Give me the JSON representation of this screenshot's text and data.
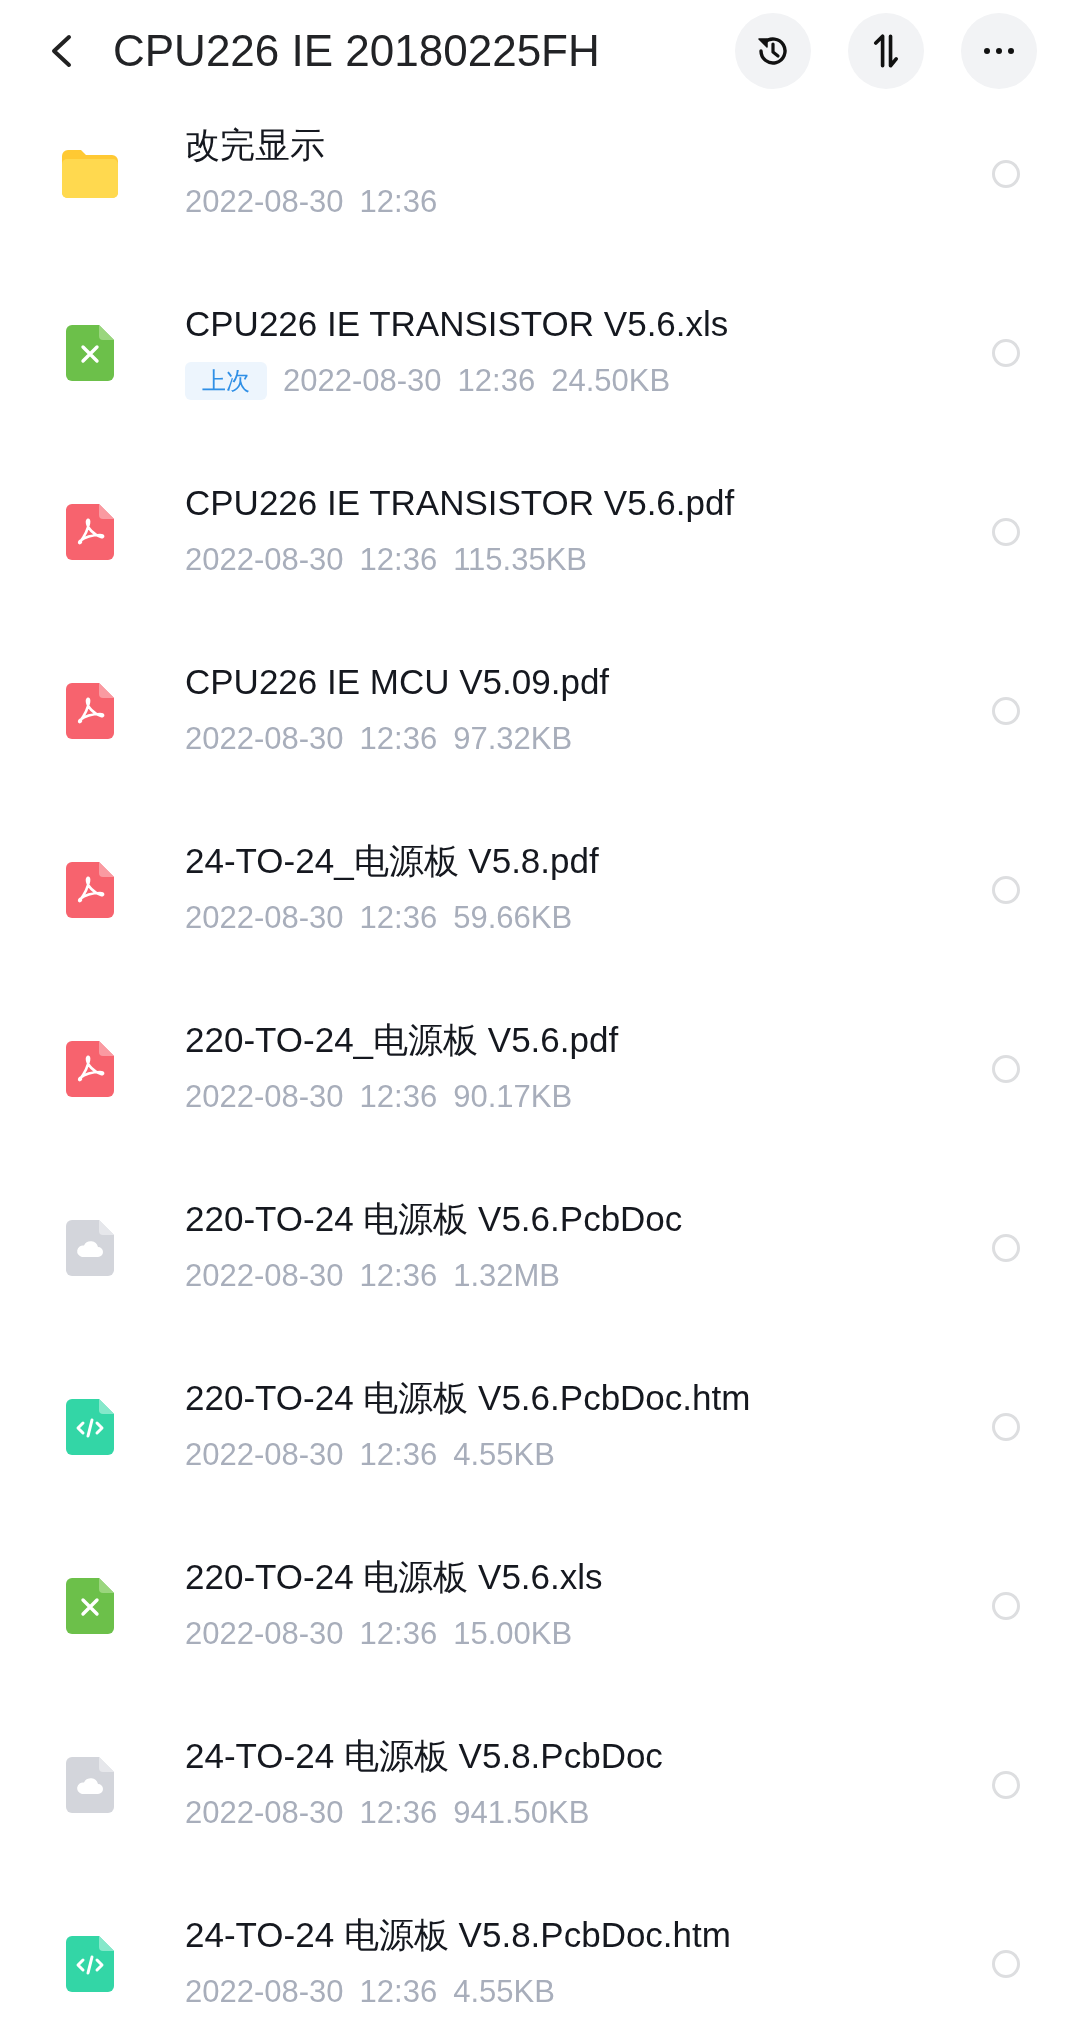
{
  "header": {
    "title": "CPU226 IE 20180225FH"
  },
  "files": [
    {
      "kind": "folder",
      "name": "改完显示",
      "date": "2022-08-30",
      "time": "12:36",
      "selected": false
    },
    {
      "kind": "sheet",
      "name": "CPU226 IE TRANSISTOR V5.6.xls",
      "badge": "上次",
      "date": "2022-08-30",
      "time": "12:36",
      "size": "24.50KB",
      "selected": false
    },
    {
      "kind": "pdf",
      "name": "CPU226 IE TRANSISTOR V5.6.pdf",
      "date": "2022-08-30",
      "time": "12:36",
      "size": "115.35KB",
      "selected": false
    },
    {
      "kind": "pdf",
      "name": "CPU226 IE MCU V5.09.pdf",
      "date": "2022-08-30",
      "time": "12:36",
      "size": "97.32KB",
      "selected": false
    },
    {
      "kind": "pdf",
      "name": "24-TO-24_电源板 V5.8.pdf",
      "date": "2022-08-30",
      "time": "12:36",
      "size": "59.66KB",
      "selected": false
    },
    {
      "kind": "pdf",
      "name": "220-TO-24_电源板 V5.6.pdf",
      "date": "2022-08-30",
      "time": "12:36",
      "size": "90.17KB",
      "selected": false
    },
    {
      "kind": "cloud",
      "name": "220-TO-24 电源板 V5.6.PcbDoc",
      "date": "2022-08-30",
      "time": "12:36",
      "size": "1.32MB",
      "selected": false
    },
    {
      "kind": "code",
      "name": "220-TO-24 电源板 V5.6.PcbDoc.htm",
      "date": "2022-08-30",
      "time": "12:36",
      "size": "4.55KB",
      "selected": false
    },
    {
      "kind": "sheet",
      "name": "220-TO-24 电源板 V5.6.xls",
      "date": "2022-08-30",
      "time": "12:36",
      "size": "15.00KB",
      "selected": false
    },
    {
      "kind": "cloud",
      "name": "24-TO-24 电源板 V5.8.PcbDoc",
      "date": "2022-08-30",
      "time": "12:36",
      "size": "941.50KB",
      "selected": false
    },
    {
      "kind": "code",
      "name": "24-TO-24 电源板 V5.8.PcbDoc.htm",
      "date": "2022-08-30",
      "time": "12:36",
      "size": "4.55KB",
      "selected": false
    }
  ]
}
